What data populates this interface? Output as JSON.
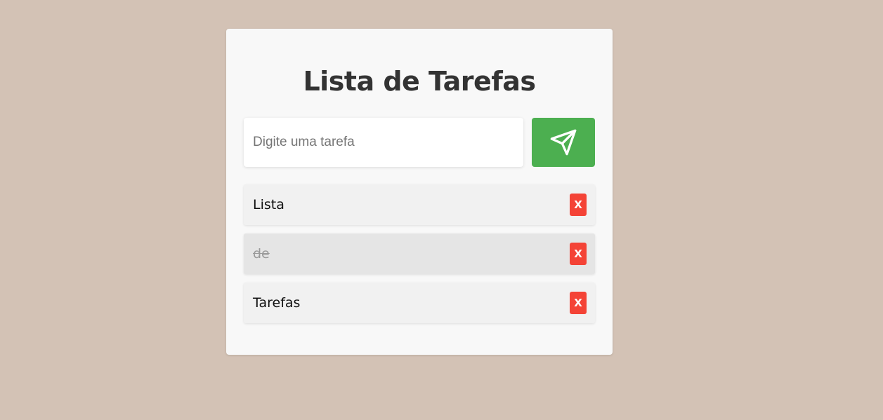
{
  "app": {
    "title": "Lista de Tarefas"
  },
  "form": {
    "input_value": "",
    "input_placeholder": "Digite uma tarefa",
    "submit_icon": "send-icon"
  },
  "tasks": [
    {
      "text": "Lista",
      "done": false,
      "delete_label": "X"
    },
    {
      "text": "de",
      "done": true,
      "delete_label": "X"
    },
    {
      "text": "Tarefas",
      "done": false,
      "delete_label": "X"
    }
  ],
  "colors": {
    "background": "#d3c2b5",
    "card": "#f8f8f8",
    "submit": "#4caf50",
    "delete": "#f44336"
  }
}
